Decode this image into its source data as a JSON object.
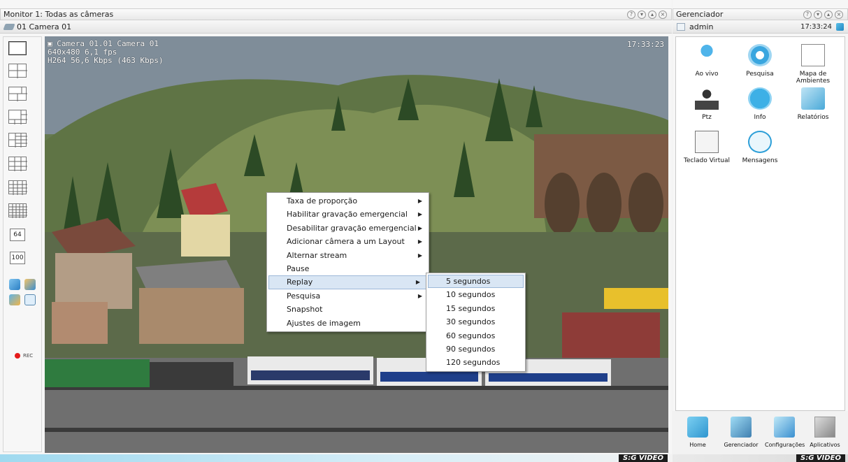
{
  "monitor": {
    "title": "Monitor 1: Todas as câmeras",
    "camera_tab": "01 Camera 01",
    "window_buttons": [
      "help-icon",
      "minimize-icon",
      "maximize-icon",
      "close-icon"
    ]
  },
  "toolbar": {
    "layouts": [
      "layout-1x1",
      "layout-2x2",
      "layout-1plus3",
      "layout-1plus5",
      "layout-3x3",
      "layout-3x3-alt",
      "layout-4x4",
      "layout-5x5"
    ],
    "num_buttons": [
      "64",
      "100"
    ],
    "rec_label": "REC"
  },
  "video": {
    "overlay_line1": "Camera 01.01 Camera 01",
    "overlay_line2": "640x480 6,1 fps",
    "overlay_line3": "H264 56,6 Kbps (463 Kbps)",
    "clock": "17:33:23"
  },
  "context_menu": {
    "items": [
      {
        "label": "Taxa de proporção",
        "submenu": true
      },
      {
        "label": "Habilitar gravação emergencial",
        "submenu": true
      },
      {
        "label": "Desabilitar gravação emergencial",
        "submenu": true
      },
      {
        "label": "Adicionar câmera a um Layout",
        "submenu": true
      },
      {
        "label": "Alternar stream",
        "submenu": true
      },
      {
        "label": "Pause",
        "submenu": false
      },
      {
        "label": "Replay",
        "submenu": true
      },
      {
        "label": "Pesquisa",
        "submenu": true
      },
      {
        "label": "Snapshot",
        "submenu": false
      },
      {
        "label": "Ajustes de imagem",
        "submenu": false
      }
    ],
    "highlighted": "Replay"
  },
  "replay_submenu": {
    "items": [
      "5 segundos",
      "10 segundos",
      "15 segundos",
      "30 segundos",
      "60 segundos",
      "90 segundos",
      "120 segundos"
    ],
    "highlighted": "5 segundos"
  },
  "manager": {
    "title": "Gerenciador",
    "user": "admin",
    "time": "17:33:24",
    "apps": [
      {
        "label": "Ao vivo",
        "icon": "live-user-icon"
      },
      {
        "label": "Pesquisa",
        "icon": "search-camera-icon"
      },
      {
        "label": "Mapa de Ambientes",
        "icon": "floor-map-icon"
      },
      {
        "label": "Ptz",
        "icon": "joystick-icon"
      },
      {
        "label": "Info",
        "icon": "info-icon"
      },
      {
        "label": "Relatórios",
        "icon": "reports-icon"
      },
      {
        "label": "Teclado Virtual",
        "icon": "keyboard-icon"
      },
      {
        "label": "Mensagens",
        "icon": "message-bubble-icon"
      }
    ],
    "footer": [
      {
        "label": "Home",
        "icon": "home-icon"
      },
      {
        "label": "Gerenciador",
        "icon": "manager-icon"
      },
      {
        "label": "Configurações",
        "icon": "settings-icon"
      },
      {
        "label": "Aplicativos",
        "icon": "apps-icon"
      }
    ]
  },
  "brand": "S:G VIDEO",
  "colors": {
    "menu_highlight": "#d9e6f4",
    "accent": "#3ba9e0",
    "rec": "#e41b1b"
  }
}
